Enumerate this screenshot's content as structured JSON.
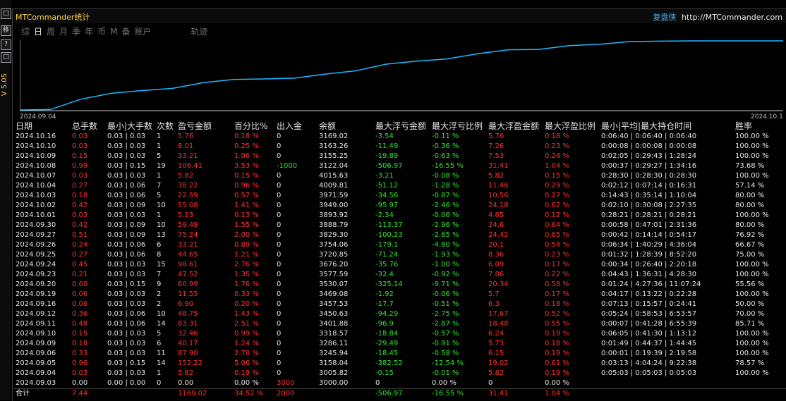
{
  "window": {
    "title": "MTCommander统计",
    "brand": "复盘侠",
    "url": "http://MTCommander.com",
    "left_buttons": [
      "□",
      "移",
      "?",
      "□"
    ],
    "side_label": "V 5.05"
  },
  "tabs": [
    {
      "label": "综",
      "active": false
    },
    {
      "label": "日",
      "active": true
    },
    {
      "label": "周",
      "active": false
    },
    {
      "label": "月",
      "active": false
    },
    {
      "label": "季",
      "active": false
    },
    {
      "label": "年",
      "active": false
    },
    {
      "label": "币",
      "active": false
    },
    {
      "label": "M",
      "active": false
    },
    {
      "label": "备",
      "active": false
    },
    {
      "label": "账户",
      "active": false
    },
    {
      "label": "轨迹",
      "active": false
    }
  ],
  "colors": {
    "line": "#1fb8ff",
    "profit": "#ff3030",
    "loss": "#2ee82e",
    "text": "#e6e6e6",
    "title": "#ffd24a"
  },
  "chart_data": {
    "type": "line",
    "x": [
      "2024.09.04",
      "2024.09.05",
      "2024.09.06",
      "2024.09.09",
      "2024.09.10",
      "2024.09.11",
      "2024.09.12",
      "2024.09.13",
      "2024.09.16",
      "2024.09.19",
      "2024.09.20",
      "2024.09.23",
      "2024.09.24",
      "2024.09.25",
      "2024.09.26",
      "2024.09.27",
      "2024.09.30",
      "2024.10.01",
      "2024.10.02",
      "2024.10.03",
      "2024.10.04",
      "2024.10.07",
      "2024.10.08",
      "2024.10.09",
      "2024.10.10",
      "2024.10.16"
    ],
    "series": [
      {
        "values": [
          3000.0,
          3005.82,
          3158.04,
          3245.94,
          3286.11,
          3318.57,
          3401.88,
          3450.63,
          3457.53,
          3469.08,
          3530.07,
          3577.59,
          3676.2,
          3720.85,
          3754.06,
          3829.3,
          3888.79,
          3893.92,
          3949.0,
          3971.59,
          4009.81,
          4015.63,
          3122.04,
          3155.25,
          3163.26,
          3169.02
        ]
      }
    ],
    "x_tick_labels": [
      "2024.09.04",
      "2024.10.16"
    ],
    "grid": false
  },
  "table": {
    "headers": [
      "日期",
      "总手数",
      "最小|大手数",
      "次数",
      "盈亏金额",
      "百分比%",
      "出入金",
      "余额",
      "最大浮亏金额",
      "最大浮亏比例",
      "最大浮盈金额",
      "最大浮盈比例",
      "最小|平均|最大持仓时间",
      "胜率"
    ],
    "rows": [
      [
        "2024.10.16",
        "0.03",
        "0.03 | 0.03",
        "1",
        "5.76",
        "0.18 %",
        "0",
        "3169.02",
        "-3.54",
        "-0.11 %",
        "5.76",
        "0.18 %",
        "0:06:40 | 0:06:40 | 0:06:40",
        "100.00 %"
      ],
      [
        "2024.10.10",
        "0.03",
        "0.03 | 0.03",
        "1",
        "8.01",
        "0.25 %",
        "0",
        "3163.26",
        "-11.49",
        "-0.36 %",
        "7.26",
        "0.23 %",
        "0:00:08 | 0:00:08 | 0:00:08",
        "100.00 %"
      ],
      [
        "2024.10.09",
        "0.15",
        "0.03 | 0.03",
        "5",
        "33.21",
        "1.06 %",
        "0",
        "3155.25",
        "-19.89",
        "-0.63 %",
        "7.53",
        "0.24 %",
        "0:02:05 | 0:29:43 | 1:28:24",
        "100.00 %"
      ],
      [
        "2024.10.08",
        "0.99",
        "0.03 | 0.15",
        "19",
        "106.41",
        "3.53 %",
        "-1000",
        "3122.04",
        "-506.97",
        "-16.55 %",
        "31.41",
        "1.04 %",
        "0:00:37 | 0:29:27 | 1:34:16",
        "73.68 %"
      ],
      [
        "2024.10.07",
        "0.03",
        "0.03 | 0.03",
        "1",
        "5.82",
        "0.15 %",
        "0",
        "4015.63",
        "-3.21",
        "-0.08 %",
        "5.82",
        "0.15 %",
        "0:28:30 | 0:28:30 | 0:28:30",
        "100.00 %"
      ],
      [
        "2024.10.04",
        "0.27",
        "0.03 | 0.06",
        "7",
        "38.22",
        "0.96 %",
        "0",
        "4009.81",
        "-51.12",
        "-1.28 %",
        "11.46",
        "0.29 %",
        "0:02:12 | 0:07:14 | 0:16:31",
        "57.14 %"
      ],
      [
        "2024.10.03",
        "0.18",
        "0.03 | 0.06",
        "5",
        "22.59",
        "0.57 %",
        "0",
        "3971.59",
        "-34.56",
        "-0.87 %",
        "10.56",
        "0.27 %",
        "0:14:43 | 0:35:14 | 1:10:04",
        "80.00 %"
      ],
      [
        "2024.10.02",
        "0.42",
        "0.03 | 0.09",
        "10",
        "55.08",
        "1.41 %",
        "0",
        "3949.00",
        "-95.97",
        "-2.46 %",
        "24.18",
        "0.62 %",
        "0:02:10 | 0:30:08 | 2:27:35",
        "80.00 %"
      ],
      [
        "2024.10.01",
        "0.03",
        "0.03 | 0.03",
        "1",
        "5.13",
        "0.13 %",
        "0",
        "3893.92",
        "-2.34",
        "-0.06 %",
        "4.65",
        "0.12 %",
        "0:28:21 | 0:28:21 | 0:28:21",
        "100.00 %"
      ],
      [
        "2024.09.30",
        "0.42",
        "0.03 | 0.09",
        "10",
        "59.49",
        "1.55 %",
        "0",
        "3888.79",
        "-113.37",
        "-2.96 %",
        "24.6",
        "0.64 %",
        "0:00:58 | 0:47:01 | 2:31:36",
        "80.00 %"
      ],
      [
        "2024.09.27",
        "0.51",
        "0.03 | 0.09",
        "13",
        "75.24",
        "2.00 %",
        "0",
        "3829.30",
        "-100.23",
        "-2.65 %",
        "24.42",
        "0.65 %",
        "0:00:42 | 0:14:14 | 0:54:17",
        "76.92 %"
      ],
      [
        "2024.09.26",
        "0.24",
        "0.03 | 0.06",
        "6",
        "33.21",
        "0.89 %",
        "0",
        "3754.06",
        "-179.1",
        "-4.80 %",
        "20.1",
        "0.54 %",
        "0:06:34 | 1:40:29 | 4:36:04",
        "66.67 %"
      ],
      [
        "2024.09.25",
        "0.27",
        "0.03 | 0.06",
        "8",
        "44.65",
        "1.21 %",
        "0",
        "3720.85",
        "-71.24",
        "-1.93 %",
        "8.36",
        "0.23 %",
        "0:01:32 | 1:28:39 | 8:52:20",
        "75.00 %"
      ],
      [
        "2024.09.24",
        "0.45",
        "0.03 | 0.03",
        "15",
        "98.61",
        "2.76 %",
        "0",
        "3676.20",
        "-35.76",
        "-1.00 %",
        "6.09",
        "0.17 %",
        "0:00:34 | 0:26:40 | 2:20:18",
        "100.00 %"
      ],
      [
        "2024.09.23",
        "0.21",
        "0.03 | 0.03",
        "7",
        "47.52",
        "1.35 %",
        "0",
        "3577.59",
        "-32.4",
        "-0.92 %",
        "7.86",
        "0.22 %",
        "0:04:43 | 1:36:31 | 4:28:30",
        "100.00 %"
      ],
      [
        "2024.09.20",
        "0.60",
        "0.03 | 0.15",
        "9",
        "60.99",
        "1.76 %",
        "0",
        "3530.07",
        "-325.14",
        "-9.71 %",
        "20.34",
        "0.58 %",
        "0:01:24 | 4:27:36 | 11:07:24",
        "55.56 %"
      ],
      [
        "2024.09.19",
        "0.06",
        "0.03 | 0.03",
        "2",
        "11.55",
        "0.33 %",
        "0",
        "3469.08",
        "-1.92",
        "-0.06 %",
        "5.7",
        "0.17 %",
        "0:04:17 | 0:13:22 | 0:22:28",
        "100.00 %"
      ],
      [
        "2024.09.16",
        "0.06",
        "0.03 | 0.03",
        "2",
        "6.90",
        "0.20 %",
        "0",
        "3457.53",
        "-17.7",
        "-0.51 %",
        "6.3",
        "0.18 %",
        "0:07:13 | 0:15:57 | 0:24:41",
        "50.00 %"
      ],
      [
        "2024.09.12",
        "0.36",
        "0.03 | 0.06",
        "10",
        "48.75",
        "1.43 %",
        "0",
        "3450.63",
        "-94.29",
        "-2.75 %",
        "17.67",
        "0.52 %",
        "0:05:24 | 0:58:53 | 6:53:57",
        "70.00 %"
      ],
      [
        "2024.09.11",
        "0.48",
        "0.03 | 0.06",
        "14",
        "83.31",
        "2.51 %",
        "0",
        "3401.88",
        "-96.9",
        "-2.87 %",
        "18.48",
        "0.55 %",
        "0:00:07 | 0:41:28 | 6:55:39",
        "85.71 %"
      ],
      [
        "2024.09.10",
        "0.15",
        "0.03 | 0.03",
        "5",
        "32.46",
        "0.99 %",
        "0",
        "3318.57",
        "-18.84",
        "-0.57 %",
        "6.24",
        "0.19 %",
        "0:06:05 | 0:41:30 | 1:13:12",
        "100.00 %"
      ],
      [
        "2024.09.09",
        "0.18",
        "0.03 | 0.03",
        "6",
        "40.17",
        "1.24 %",
        "0",
        "3286.11",
        "-29.49",
        "-0.91 %",
        "5.73",
        "0.18 %",
        "0:01:49 | 0:44:37 | 1:44:45",
        "100.00 %"
      ],
      [
        "2024.09.06",
        "0.33",
        "0.03 | 0.03",
        "11",
        "87.90",
        "2.78 %",
        "0",
        "3245.94",
        "-18.45",
        "-0.58 %",
        "6.15",
        "0.19 %",
        "0:00:01 | 0:19:39 | 2:19:58",
        "100.00 %"
      ],
      [
        "2024.09.05",
        "0.96",
        "0.03 | 0.15",
        "14",
        "152.22",
        "5.06 %",
        "0",
        "3158.04",
        "-382.52",
        "-12.54 %",
        "19.02",
        "0.61 %",
        "0:03:13 | 4:04:24 | 9:22:38",
        "78.57 %"
      ],
      [
        "2024.09.04",
        "0.03",
        "0.03 | 0.03",
        "1",
        "5.82",
        "0.19 %",
        "0",
        "3005.82",
        "-0.15",
        "-0.01 %",
        "5.82",
        "0.19 %",
        "0:05:03 | 0:05:03 | 0:05:03",
        "100.00 %"
      ],
      [
        "2024.09.03",
        "0.00",
        "0.00 | 0.00",
        "0",
        "0.00",
        "0.00 %",
        "3000",
        "3000.00",
        "0",
        "0.00 %",
        "0",
        "0.00 %",
        "",
        ""
      ]
    ],
    "total": [
      "合计",
      "7.44",
      "",
      "",
      "1169.02",
      "34.52 %",
      "2000",
      "",
      "-506.97",
      "-16.55 %",
      "31.41",
      "1.04 %",
      "",
      ""
    ]
  }
}
